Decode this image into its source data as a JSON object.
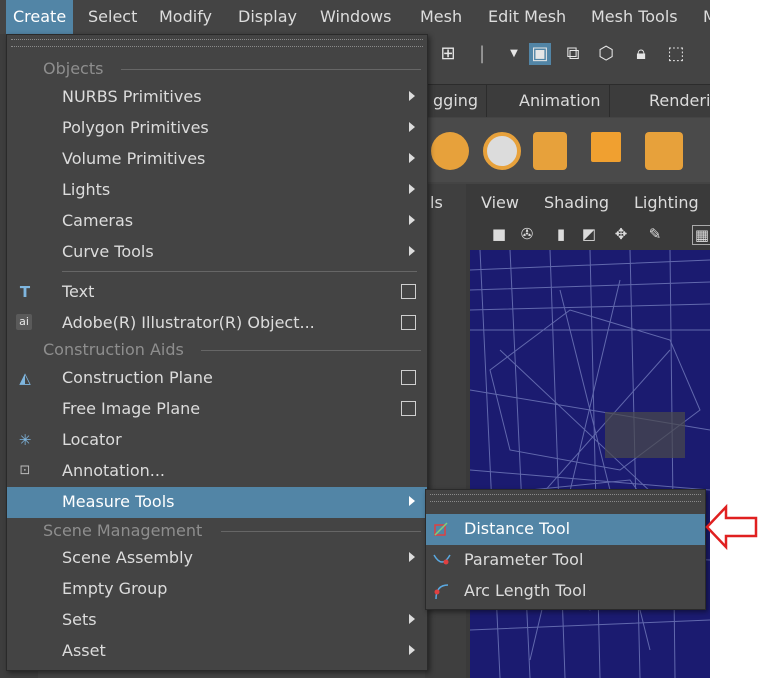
{
  "menubar": {
    "items": [
      {
        "label": "Create",
        "active": true
      },
      {
        "label": "Select"
      },
      {
        "label": "Modify"
      },
      {
        "label": "Display"
      },
      {
        "label": "Windows"
      },
      {
        "label": "Mesh"
      },
      {
        "label": "Edit Mesh"
      },
      {
        "label": "Mesh Tools"
      },
      {
        "label": "M"
      }
    ]
  },
  "tabs": [
    {
      "label": "gging"
    },
    {
      "label": "Animation"
    },
    {
      "label": "Renderi"
    }
  ],
  "viewport": {
    "menu": [
      {
        "label": "ls"
      },
      {
        "label": "View"
      },
      {
        "label": "Shading"
      },
      {
        "label": "Lighting"
      }
    ]
  },
  "create_menu": {
    "sections": {
      "objects": "Objects",
      "construction_aids": "Construction Aids",
      "scene_management": "Scene Management"
    },
    "items": {
      "nurbs": "NURBS Primitives",
      "polygon": "Polygon Primitives",
      "volume": "Volume Primitives",
      "lights": "Lights",
      "cameras": "Cameras",
      "curve_tools": "Curve Tools",
      "text": "Text",
      "illustrator": "Adobe(R) Illustrator(R) Object...",
      "construction_plane": "Construction Plane",
      "free_image_plane": "Free Image Plane",
      "locator": "Locator",
      "annotation": "Annotation...",
      "measure_tools": "Measure Tools",
      "scene_assembly": "Scene Assembly",
      "empty_group": "Empty Group",
      "sets": "Sets",
      "asset": "Asset"
    },
    "icons": {
      "text": "T",
      "illustrator": "ai",
      "locator": "✳"
    }
  },
  "measure_submenu": {
    "items": [
      {
        "label": "Distance Tool",
        "highlighted": true
      },
      {
        "label": "Parameter Tool"
      },
      {
        "label": "Arc Length Tool"
      }
    ]
  },
  "colors": {
    "highlight": "#5285a6",
    "menu_bg": "#444444",
    "callout_arrow": "#e02020",
    "wireframe_bg": "#1b1b70"
  }
}
